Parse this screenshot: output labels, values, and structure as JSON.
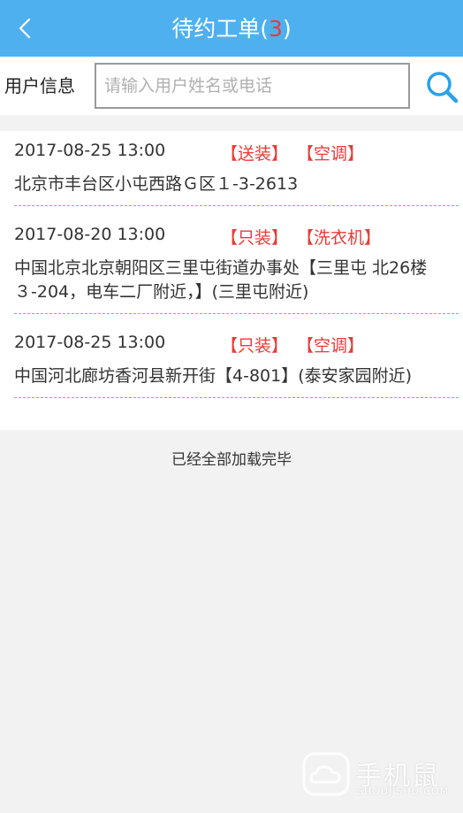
{
  "header": {
    "title": "待约工单",
    "count_open": "(",
    "count": "3",
    "count_close": ")"
  },
  "search": {
    "label": "用户信息",
    "placeholder": "请输入用户姓名或电话",
    "value": ""
  },
  "orders": [
    {
      "datetime": "2017-08-25 13:00",
      "service_tag": "【送装】",
      "product_tag": "【空调】",
      "address": "北京市丰台区小屯西路Ｇ区１-3-2613"
    },
    {
      "datetime": "2017-08-20 13:00",
      "service_tag": "【只装】",
      "product_tag": "【洗衣机】",
      "address": "中国北京北京朝阳区三里屯街道办事处【三里屯 北26楼３-204，电车二厂附近，】(三里屯附近)"
    },
    {
      "datetime": "2017-08-25 13:00",
      "service_tag": "【只装】",
      "product_tag": "【空调】",
      "address": "中国河北廊坊香河县新开街【4-801】(泰安家园附近)"
    }
  ],
  "footer": {
    "loaded_text": "已经全部加载完毕"
  },
  "watermark": {
    "brand": "手机鼠",
    "domain": "SHOUJISHU.COM"
  },
  "colors": {
    "nav_bg": "#4fb0f0",
    "accent_red": "#e83b36",
    "divider_blue": "#5cb5e9"
  }
}
